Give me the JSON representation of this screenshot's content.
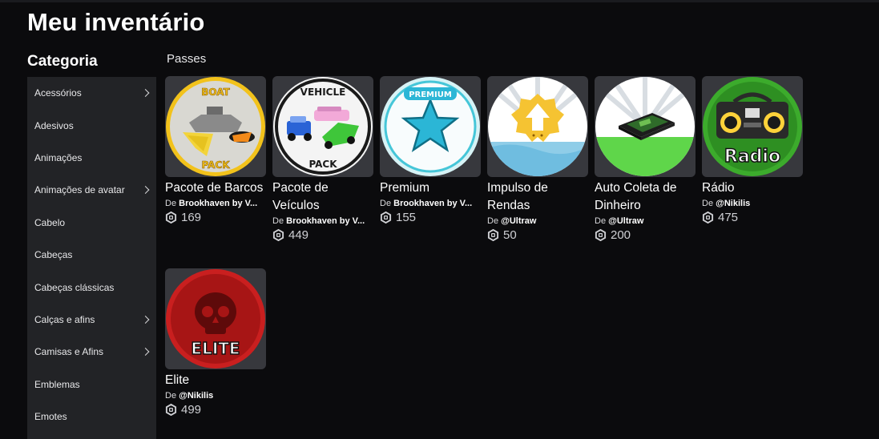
{
  "header": {
    "title": "Meu inventário"
  },
  "sidebar": {
    "title": "Categoria",
    "items": [
      {
        "label": "Acessórios",
        "chevron": true
      },
      {
        "label": "Adesivos",
        "chevron": false
      },
      {
        "label": "Animações",
        "chevron": false
      },
      {
        "label": "Animações de avatar",
        "chevron": true
      },
      {
        "label": "Cabelo",
        "chevron": false
      },
      {
        "label": "Cabeças",
        "chevron": false
      },
      {
        "label": "Cabeças clássicas",
        "chevron": false
      },
      {
        "label": "Calças e afins",
        "chevron": true
      },
      {
        "label": "Camisas e Afins",
        "chevron": true
      },
      {
        "label": "Emblemas",
        "chevron": false
      },
      {
        "label": "Emotes",
        "chevron": false
      }
    ]
  },
  "main": {
    "section": "Passes",
    "creator_prefix": "De",
    "items": [
      {
        "name": "Pacote de Barcos",
        "creator": "Brookhaven by V...",
        "price": "169",
        "icon": "boat-pack-icon",
        "art_text": [
          "BOAT",
          "PACK"
        ]
      },
      {
        "name": "Pacote de Veículos",
        "creator": "Brookhaven by V...",
        "price": "449",
        "icon": "vehicle-pack-icon",
        "art_text": [
          "VEHICLE",
          "PACK"
        ]
      },
      {
        "name": "Premium",
        "creator": "Brookhaven by V...",
        "price": "155",
        "icon": "premium-star-icon",
        "art_text": [
          "PREMIUM"
        ]
      },
      {
        "name": "Impulso de Rendas",
        "creator": "@Ultraw",
        "price": "50",
        "icon": "income-boost-icon",
        "art_text": []
      },
      {
        "name": "Auto Coleta de Dinheiro",
        "creator": "@Ultraw",
        "price": "200",
        "icon": "auto-collect-money-icon",
        "art_text": []
      },
      {
        "name": "Rádio",
        "creator": "@Nikilis",
        "price": "475",
        "icon": "radio-icon",
        "art_text": [
          "Radio"
        ]
      },
      {
        "name": "Elite",
        "creator": "@Nikilis",
        "price": "499",
        "icon": "elite-skull-icon",
        "art_text": [
          "ELITE"
        ]
      }
    ]
  },
  "colors": {
    "background": "#0b0b0d",
    "sidebar": "#222326",
    "card": "#37383d",
    "price_text": "#cfd0d4"
  }
}
